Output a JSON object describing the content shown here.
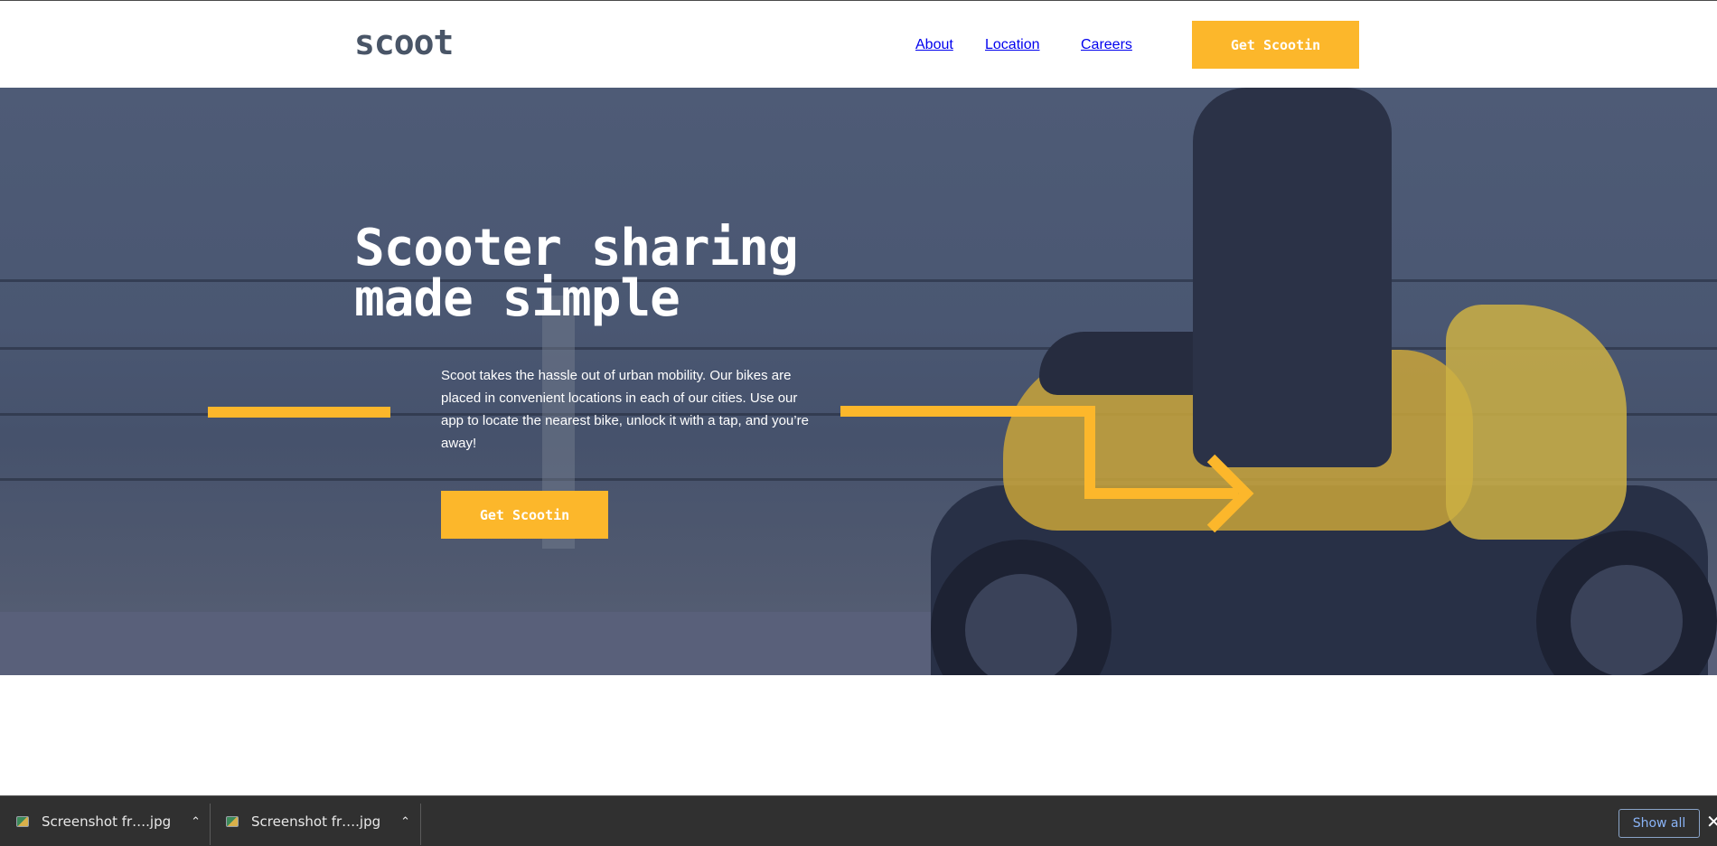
{
  "header": {
    "logo": "scoot",
    "nav": [
      "About",
      "Location",
      "Careers"
    ],
    "cta": "Get Scootin"
  },
  "hero": {
    "title_line1": "Scooter sharing",
    "title_line2": "made simple",
    "text": "Scoot takes the hassle out of urban mobility. Our bikes are placed in convenient locations in each of our cities. Use our app to locate the nearest bike, unlock it with a tap, and you’re away!",
    "cta": "Get Scootin"
  },
  "downloads": {
    "items": [
      "Screenshot fr….jpg",
      "Screenshot fr….jpg"
    ],
    "show_all": "Show all",
    "close": "✕"
  },
  "colors": {
    "accent": "#fcb72b",
    "dark_navy": "#495567",
    "nav_gray": "#939cab"
  }
}
